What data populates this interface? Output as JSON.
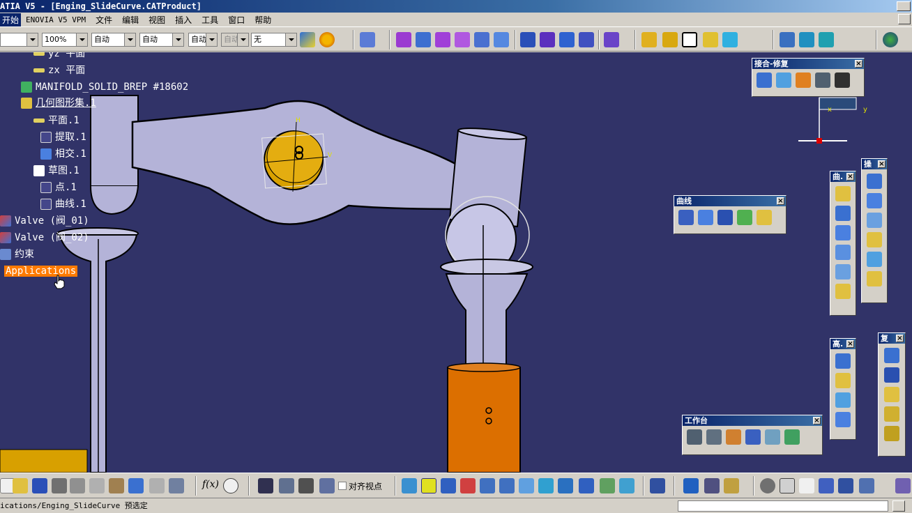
{
  "window": {
    "title": "ATIA V5 - [Enging_SlideCurve.CATProduct]"
  },
  "menu": {
    "items": [
      "开始",
      "ENOVIA V5 VPM",
      "文件",
      "编辑",
      "视图",
      "插入",
      "工具",
      "窗口",
      "帮助"
    ]
  },
  "toolbar_top": {
    "combo1": "",
    "zoom": "100%",
    "combo3": "自动",
    "combo4": "自动",
    "combo5": "自动",
    "combo6_disabled": "自动",
    "combo7": "无"
  },
  "tree": {
    "items": [
      {
        "label": "yz 平面"
      },
      {
        "label": "zx 平面"
      },
      {
        "label": "MANIFOLD_SOLID_BREP #18602"
      },
      {
        "label": "几何图形集.1"
      },
      {
        "label": "平面.1"
      },
      {
        "label": "提取.1"
      },
      {
        "label": "相交.1"
      },
      {
        "label": "草图.1"
      },
      {
        "label": "点.1"
      },
      {
        "label": "曲线.1"
      },
      {
        "label": "Valve (阀_01)"
      },
      {
        "label": "Valve (阀_02)"
      },
      {
        "label": "约束"
      },
      {
        "label": "Applications"
      }
    ]
  },
  "floating_toolbars": {
    "join_heal": {
      "title": "接合-修复"
    },
    "curves": {
      "title": "曲线"
    },
    "curves_short": {
      "title": "曲."
    },
    "operations": {
      "title": "操"
    },
    "advanced": {
      "title": "高."
    },
    "replication": {
      "title": "复"
    },
    "workbench": {
      "title": "工作台"
    }
  },
  "compass": {
    "x_label": "x",
    "y_label": "y"
  },
  "sketch": {
    "h_label": "H",
    "v_label": "V"
  },
  "toolbar_bottom": {
    "align_viewpoint_label": "对齐视点",
    "formula_label": "f(x)"
  },
  "status": {
    "text": "ications/Enging_SlideCurve 预选定"
  },
  "colors": {
    "viewport_bg": "#313368",
    "part_fill": "#b4b3d8",
    "selected_bg": "#ff7a00",
    "pin_orange": "#dc6f00",
    "disc_gold": "#d8a000"
  }
}
